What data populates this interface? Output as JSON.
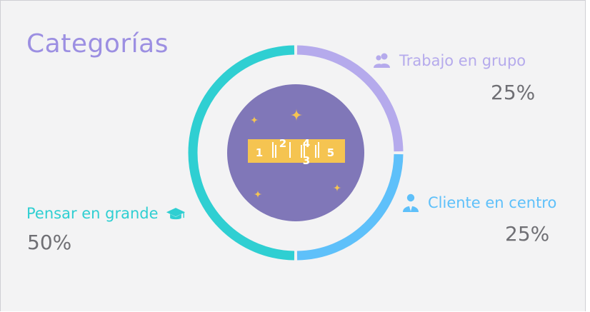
{
  "title": "Categorías",
  "chart_data": {
    "type": "pie",
    "title": "Categorías",
    "slices": [
      {
        "label": "Trabajo en grupo",
        "value": 25,
        "value_label": "25%",
        "color": "#b5aaec",
        "icon": "users-icon"
      },
      {
        "label": "Cliente en centro",
        "value": 25,
        "value_label": "25%",
        "color": "#5ec0fa",
        "icon": "user-tie-icon"
      },
      {
        "label": "Pensar en grande",
        "value": 50,
        "value_label": "50%",
        "color": "#2fcfd2",
        "icon": "graduation-cap-icon"
      }
    ]
  },
  "center_badge": {
    "numbers": [
      "1",
      "2",
      "4",
      "3",
      "5"
    ],
    "color": "#f5c451",
    "background": "#8077b8"
  },
  "colors": {
    "title": "#9c8fe2",
    "percent": "#6f6f74",
    "card": "#f3f3f4"
  }
}
